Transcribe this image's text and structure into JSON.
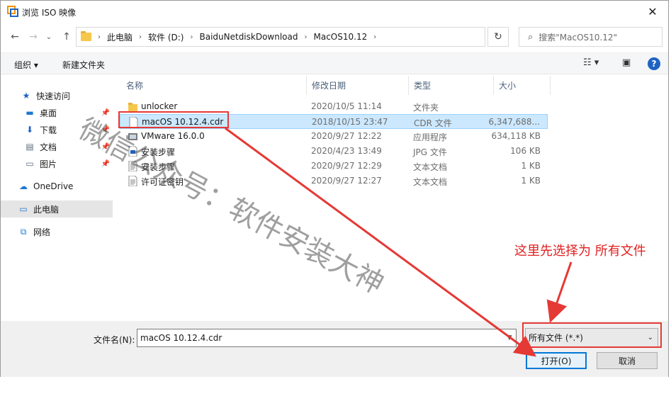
{
  "window": {
    "title": "浏览 ISO 映像",
    "close_glyph": "✕"
  },
  "nav": {
    "back": "←",
    "forward": "→",
    "dropdown": "⌄",
    "up": "↑"
  },
  "address": {
    "crumbs": [
      "此电脑",
      "软件 (D:)",
      "BaiduNetdiskDownload",
      "MacOS10.12"
    ],
    "separator": "›",
    "dropdown": "⌄",
    "refresh": "↻"
  },
  "search": {
    "placeholder": "搜索\"MacOS10.12\"",
    "icon": "⌕"
  },
  "toolbar": {
    "organize": "组织 ▾",
    "new_folder": "新建文件夹",
    "view": "☷ ▾",
    "pane": "▣",
    "help": "?"
  },
  "sidebar": {
    "items": [
      {
        "label": "快速访问",
        "icon": "star-icon",
        "glyph": "★",
        "color": "#1e63c4"
      },
      {
        "label": "桌面",
        "icon": "desktop-icon",
        "glyph": "▬",
        "color": "#1e78d0",
        "pinned": true
      },
      {
        "label": "下载",
        "icon": "download-icon",
        "glyph": "⬇",
        "color": "#1e63c4",
        "pinned": true
      },
      {
        "label": "文档",
        "icon": "document-icon",
        "glyph": "▤",
        "color": "#5a6b7c",
        "pinned": true
      },
      {
        "label": "图片",
        "icon": "pictures-icon",
        "glyph": "▭",
        "color": "#5a6b7c",
        "pinned": true
      },
      {
        "label": "OneDrive",
        "icon": "onedrive-icon",
        "glyph": "☁",
        "color": "#1e78d0"
      },
      {
        "label": "此电脑",
        "icon": "computer-icon",
        "glyph": "▭",
        "color": "#1e78d0",
        "selected": true
      },
      {
        "label": "网络",
        "icon": "network-icon",
        "glyph": "⧉",
        "color": "#1e78d0"
      }
    ],
    "pin_glyph": "📌"
  },
  "columns": {
    "name": "名称",
    "date": "修改日期",
    "type": "类型",
    "size": "大小"
  },
  "files": [
    {
      "name": "unlocker",
      "date": "2020/10/5 11:14",
      "type": "文件夹",
      "size": "",
      "icon": "folder-icon"
    },
    {
      "name": "macOS 10.12.4.cdr",
      "date": "2018/10/15 23:47",
      "type": "CDR 文件",
      "size": "6,347,688...",
      "icon": "file-icon",
      "selected": true
    },
    {
      "name": "VMware 16.0.0",
      "date": "2020/9/27 12:22",
      "type": "应用程序",
      "size": "634,118 KB",
      "icon": "vmware-icon"
    },
    {
      "name": "安装步骤",
      "date": "2020/4/23 13:49",
      "type": "JPG 文件",
      "size": "106 KB",
      "icon": "image-icon"
    },
    {
      "name": "安装步骤",
      "date": "2020/9/27 12:29",
      "type": "文本文档",
      "size": "1 KB",
      "icon": "text-icon"
    },
    {
      "name": "许可证密钥",
      "date": "2020/9/27 12:27",
      "type": "文本文档",
      "size": "1 KB",
      "icon": "text-icon"
    }
  ],
  "footer": {
    "filename_label": "文件名(N):",
    "filename_value": "macOS 10.12.4.cdr",
    "filetype_value": "所有文件 (*.*)",
    "open_label": "打开(O)",
    "cancel_label": "取消"
  },
  "annotations": {
    "callout": "这里先选择为 所有文件",
    "watermark": "微信公众号：软件安装大神",
    "highlight_color": "#e53935"
  }
}
